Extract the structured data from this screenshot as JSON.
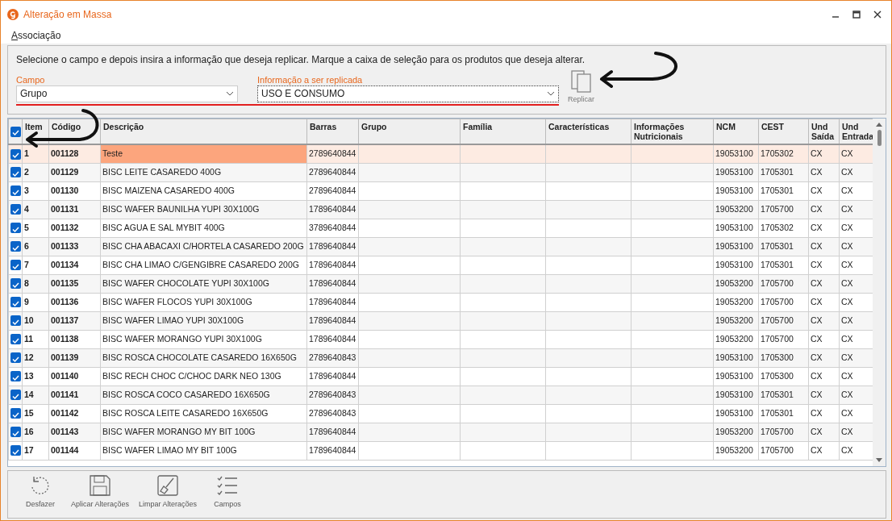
{
  "window": {
    "title": "Alteração em Massa"
  },
  "menu": [
    {
      "label": "Associação"
    }
  ],
  "filter": {
    "instruction": "Selecione o campo e depois insira a informação que deseja replicar. Marque a caixa de seleção para os produtos que deseja alterar.",
    "campo": {
      "label": "Campo",
      "value": "Grupo"
    },
    "info": {
      "label": "Informação a ser replicada",
      "value": "USO E CONSUMO"
    },
    "replicate_button": "Replicar"
  },
  "table": {
    "all_checked": true,
    "columns": [
      "Item",
      "Código",
      "Descrição",
      "Barras",
      "Grupo",
      "Família",
      "Características",
      "Informações Nutricionais",
      "NCM",
      "CEST",
      "Und Saída",
      "Und Entrada"
    ],
    "rows": [
      {
        "checked": true,
        "selected": true,
        "cells": [
          "1",
          "001128",
          "Teste",
          "2789640844",
          "",
          "",
          "",
          "",
          "19053100",
          "1705302",
          "CX",
          "CX"
        ]
      },
      {
        "checked": true,
        "selected": false,
        "cells": [
          "2",
          "001129",
          "BISC LEITE CASAREDO 400G",
          "2789640844",
          "",
          "",
          "",
          "",
          "19053100",
          "1705301",
          "CX",
          "CX"
        ]
      },
      {
        "checked": true,
        "selected": false,
        "cells": [
          "3",
          "001130",
          "BISC MAIZENA CASAREDO 400G",
          "2789640844",
          "",
          "",
          "",
          "",
          "19053100",
          "1705301",
          "CX",
          "CX"
        ]
      },
      {
        "checked": true,
        "selected": false,
        "cells": [
          "4",
          "001131",
          "BISC WAFER BAUNILHA YUPI 30X100G",
          "1789640844",
          "",
          "",
          "",
          "",
          "19053200",
          "1705700",
          "CX",
          "CX"
        ]
      },
      {
        "checked": true,
        "selected": false,
        "cells": [
          "5",
          "001132",
          "BISC AGUA E SAL MYBIT 400G",
          "3789640844",
          "",
          "",
          "",
          "",
          "19053100",
          "1705302",
          "CX",
          "CX"
        ]
      },
      {
        "checked": true,
        "selected": false,
        "cells": [
          "6",
          "001133",
          "BISC CHA ABACAXI C/HORTELA CASAREDO 200G",
          "1789640844",
          "",
          "",
          "",
          "",
          "19053100",
          "1705301",
          "CX",
          "CX"
        ]
      },
      {
        "checked": true,
        "selected": false,
        "cells": [
          "7",
          "001134",
          "BISC CHA LIMAO C/GENGIBRE CASAREDO 200G",
          "1789640844",
          "",
          "",
          "",
          "",
          "19053100",
          "1705301",
          "CX",
          "CX"
        ]
      },
      {
        "checked": true,
        "selected": false,
        "cells": [
          "8",
          "001135",
          "BISC WAFER CHOCOLATE YUPI 30X100G",
          "1789640844",
          "",
          "",
          "",
          "",
          "19053200",
          "1705700",
          "CX",
          "CX"
        ]
      },
      {
        "checked": true,
        "selected": false,
        "cells": [
          "9",
          "001136",
          "BISC WAFER FLOCOS YUPI 30X100G",
          "1789640844",
          "",
          "",
          "",
          "",
          "19053200",
          "1705700",
          "CX",
          "CX"
        ]
      },
      {
        "checked": true,
        "selected": false,
        "cells": [
          "10",
          "001137",
          "BISC WAFER LIMAO YUPI 30X100G",
          "1789640844",
          "",
          "",
          "",
          "",
          "19053200",
          "1705700",
          "CX",
          "CX"
        ]
      },
      {
        "checked": true,
        "selected": false,
        "cells": [
          "11",
          "001138",
          "BISC WAFER MORANGO YUPI 30X100G",
          "1789640844",
          "",
          "",
          "",
          "",
          "19053200",
          "1705700",
          "CX",
          "CX"
        ]
      },
      {
        "checked": true,
        "selected": false,
        "cells": [
          "12",
          "001139",
          "BISC ROSCA CHOCOLATE CASAREDO 16X650G",
          "2789640843",
          "",
          "",
          "",
          "",
          "19053100",
          "1705300",
          "CX",
          "CX"
        ]
      },
      {
        "checked": true,
        "selected": false,
        "cells": [
          "13",
          "001140",
          "BISC RECH CHOC C/CHOC DARK NEO 130G",
          "1789640844",
          "",
          "",
          "",
          "",
          "19053100",
          "1705300",
          "CX",
          "CX"
        ]
      },
      {
        "checked": true,
        "selected": false,
        "cells": [
          "14",
          "001141",
          "BISC ROSCA COCO CASAREDO 16X650G",
          "2789640843",
          "",
          "",
          "",
          "",
          "19053100",
          "1705301",
          "CX",
          "CX"
        ]
      },
      {
        "checked": true,
        "selected": false,
        "cells": [
          "15",
          "001142",
          "BISC ROSCA LEITE CASAREDO 16X650G",
          "2789640843",
          "",
          "",
          "",
          "",
          "19053100",
          "1705301",
          "CX",
          "CX"
        ]
      },
      {
        "checked": true,
        "selected": false,
        "cells": [
          "16",
          "001143",
          "BISC WAFER MORANGO MY BIT 100G",
          "1789640844",
          "",
          "",
          "",
          "",
          "19053200",
          "1705700",
          "CX",
          "CX"
        ]
      },
      {
        "checked": true,
        "selected": false,
        "cells": [
          "17",
          "001144",
          "BISC WAFER LIMAO MY BIT 100G",
          "1789640844",
          "",
          "",
          "",
          "",
          "19053200",
          "1705700",
          "CX",
          "CX"
        ]
      }
    ]
  },
  "toolbar": [
    {
      "kind": "undo",
      "label": "Desfazer"
    },
    {
      "kind": "save",
      "label": "Aplicar Alterações"
    },
    {
      "kind": "brush",
      "label": "Limpar Alterações"
    },
    {
      "kind": "list",
      "label": "Campos"
    }
  ]
}
